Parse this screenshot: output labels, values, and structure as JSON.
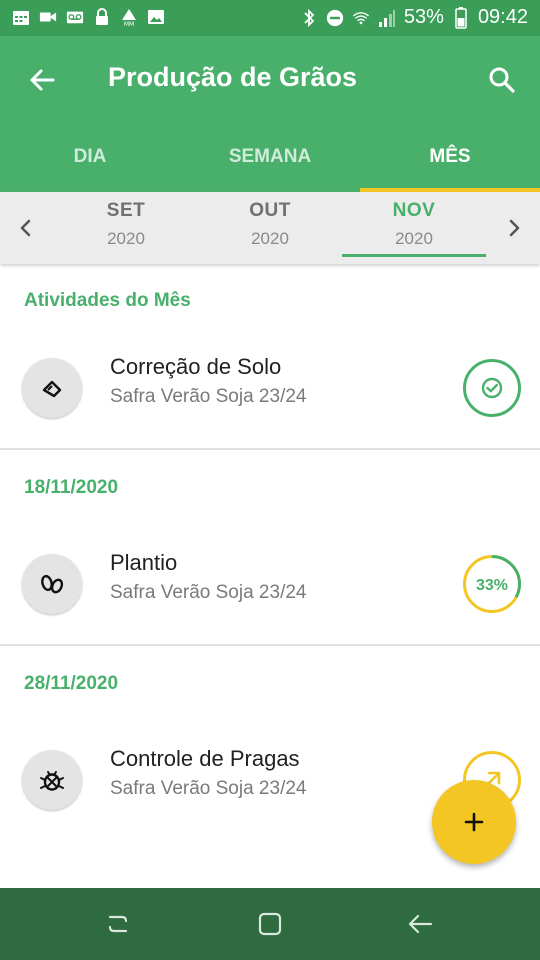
{
  "status_bar": {
    "battery": "53%",
    "time": "09:42",
    "icons_left": [
      "calendar-icon",
      "video-icon",
      "voicemail-icon",
      "lock-icon",
      "mm-icon",
      "image-icon"
    ],
    "icons_right": [
      "bluetooth-icon",
      "do-not-disturb-icon",
      "wifi-icon",
      "signal-icon",
      "battery-icon"
    ]
  },
  "app_bar": {
    "title": "Produção de Grãos"
  },
  "tabs": [
    {
      "label": "DIA",
      "active": false
    },
    {
      "label": "SEMANA",
      "active": false
    },
    {
      "label": "MÊS",
      "active": true
    }
  ],
  "months": [
    {
      "name": "SET",
      "year": "2020",
      "active": false
    },
    {
      "name": "OUT",
      "year": "2020",
      "active": false
    },
    {
      "name": "NOV",
      "year": "2020",
      "active": true
    }
  ],
  "sections": [
    {
      "header": "Atividades do Mês",
      "activity": {
        "title": "Correção de Solo",
        "subtitle": "Safra Verão Soja 23/24",
        "icon": "soil-correction-icon",
        "status": "completed"
      }
    },
    {
      "header": "18/11/2020",
      "activity": {
        "title": "Plantio",
        "subtitle": "Safra Verão Soja 23/24",
        "icon": "seeds-icon",
        "status": "in-progress",
        "progress_label": "33%",
        "progress": 0.33
      }
    },
    {
      "header": "28/11/2020",
      "activity": {
        "title": "Controle de Pragas",
        "subtitle": "Safra Verão Soja 23/24",
        "icon": "pest-icon",
        "status": "pending"
      }
    }
  ],
  "fab": {
    "label": "+"
  },
  "colors": {
    "primary": "#49b06c",
    "status_bar": "#3a9d58",
    "accent": "#f3c623",
    "nav_bar": "#2e6b3e"
  }
}
